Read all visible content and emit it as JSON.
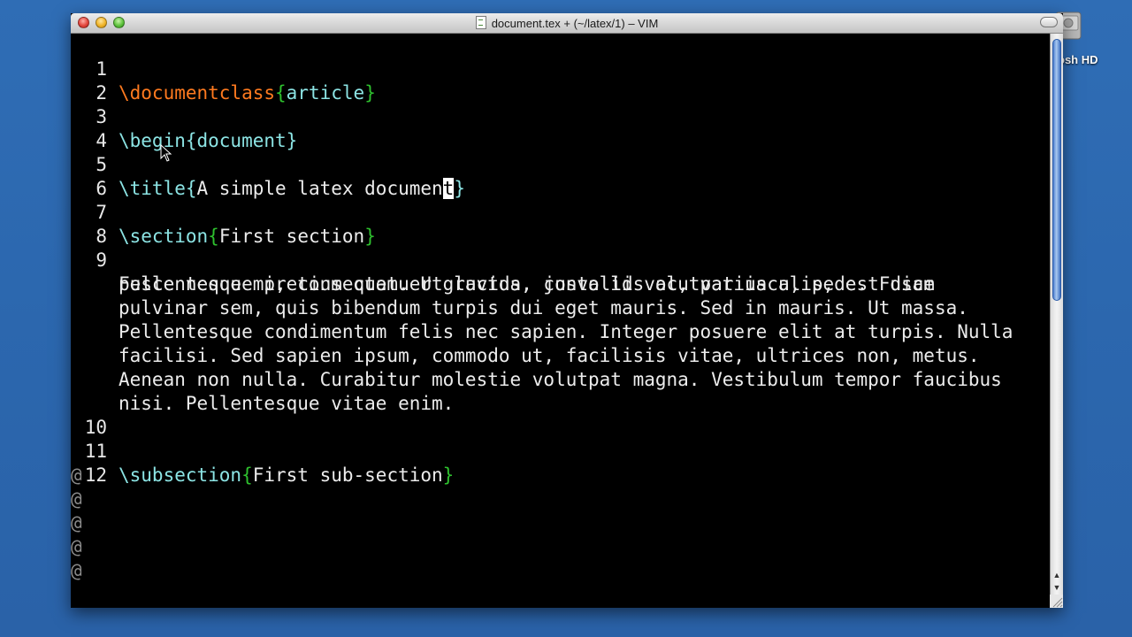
{
  "desktop": {
    "drive_label": "osh HD"
  },
  "window": {
    "title": "document.tex + (~/latex/1) – VIM"
  },
  "editor": {
    "lines": [
      {
        "num": "1"
      },
      {
        "num": "2"
      },
      {
        "num": "3"
      },
      {
        "num": "4"
      },
      {
        "num": "5"
      },
      {
        "num": "6"
      },
      {
        "num": "7"
      },
      {
        "num": "8"
      },
      {
        "num": "9"
      },
      {
        "num": "10"
      },
      {
        "num": "11"
      },
      {
        "num": "12"
      }
    ],
    "l1": {
      "cmd": "\\documentclass",
      "open": "{",
      "arg": "article",
      "close": "}"
    },
    "l3": {
      "text": "\\begin{document}"
    },
    "l5": {
      "cmd": "\\title",
      "open": "{",
      "arg_before": "A simple latex documen",
      "cursor_char": "t",
      "close": "}"
    },
    "l7": {
      "cmd": "\\section",
      "open": "{",
      "arg": "First section",
      "close": "}"
    },
    "l9": [
      "Fusce neque mi, consectetuer gravida, convallis ac, varius a, pede. Fusce",
      "pellentesque pretium quam. Ut luctus, justo id volutpat iaculis, est diam",
      "pulvinar sem, quis bibendum turpis dui eget mauris. Sed in mauris. Ut massa.",
      "Pellentesque condimentum felis nec sapien. Integer posuere elit at turpis. Nulla",
      "facilisi. Sed sapien ipsum, commodo ut, facilisis vitae, ultrices non, metus.",
      "Aenean non nulla. Curabitur molestie volutpat magna. Vestibulum tempor faucibus",
      "nisi. Pellentesque vitae enim."
    ],
    "l11": {
      "cmd": "\\subsection",
      "open": "{",
      "arg": "First sub-section",
      "close": "}"
    },
    "filler": "@"
  },
  "colors": {
    "background": "#000000",
    "command_orange": "#ff7a1f",
    "command_cyan": "#8ce4e4",
    "brace_green": "#2ec02e",
    "text": "#e8e8e8",
    "filler": "#8a8a8a"
  },
  "icons": {
    "close": "close-button",
    "minimize": "minimize-button",
    "zoom": "zoom-button",
    "toolbar_toggle": "toolbar-pill-button",
    "file": "document-icon",
    "drive": "hard-drive-icon",
    "pointer": "mouse-pointer-icon"
  }
}
